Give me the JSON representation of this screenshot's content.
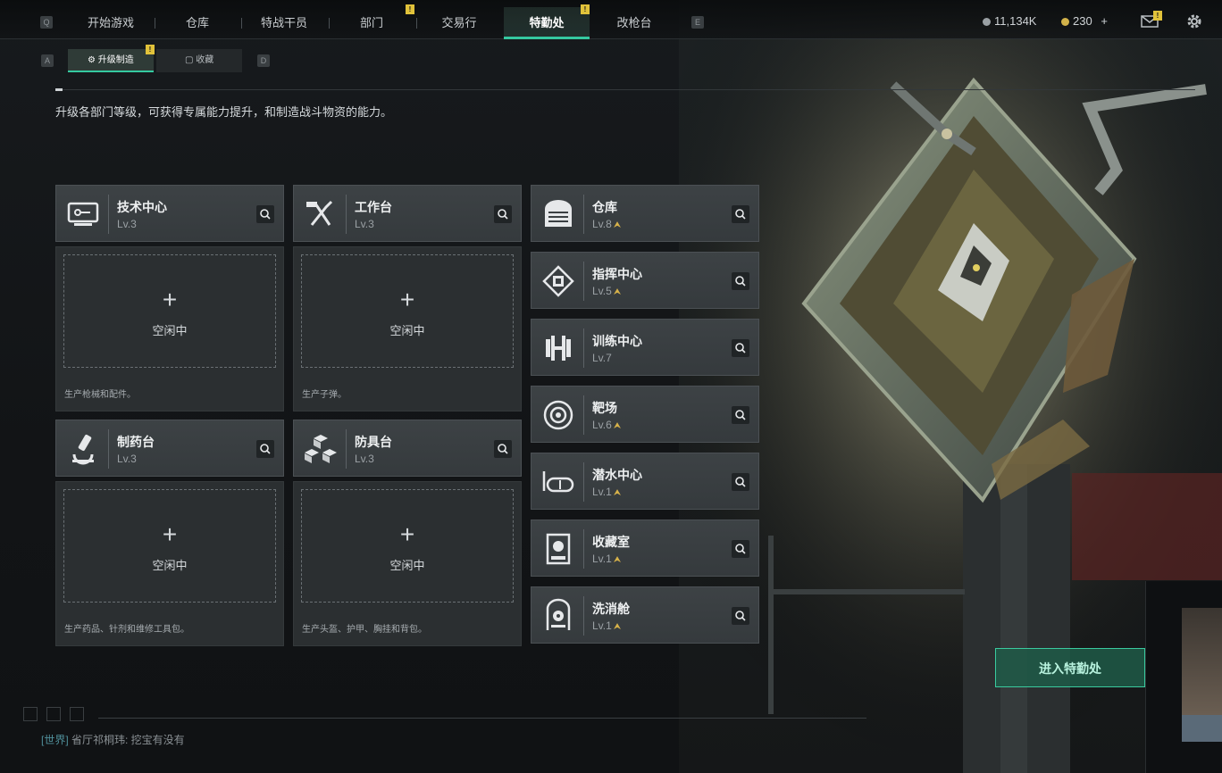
{
  "topbar": {
    "left_key": "Q",
    "right_key": "E",
    "tabs": [
      {
        "label": "开始游戏",
        "badge": ""
      },
      {
        "label": "仓库",
        "badge": ""
      },
      {
        "label": "特战干员",
        "badge": ""
      },
      {
        "label": "部门",
        "badge": "!"
      },
      {
        "label": "交易行",
        "badge": ""
      },
      {
        "label": "特勤处",
        "badge": "!",
        "active": true
      },
      {
        "label": "改枪台",
        "badge": ""
      }
    ],
    "currency_1": "11,134K",
    "currency_2": "230",
    "currency_2_add": "+",
    "mail_badge": "!"
  },
  "subtabs": {
    "left_key": "A",
    "right_key": "D",
    "items": [
      {
        "label": "升级制造",
        "badge": "!",
        "active": true
      },
      {
        "label": "收藏",
        "badge": ""
      }
    ]
  },
  "description": "升级各部门等级，可获得专属能力提升，和制造战斗物资的能力。",
  "production_facilities": [
    {
      "name": "技术中心",
      "level": "Lv.3",
      "icon": "computer-icon",
      "slot_status": "空闲中",
      "slot_plus": "+",
      "slot_desc": "生产枪械和配件。"
    },
    {
      "name": "工作台",
      "level": "Lv.3",
      "icon": "tools-icon",
      "slot_status": "空闲中",
      "slot_plus": "+",
      "slot_desc": "生产子弹。"
    },
    {
      "name": "制药台",
      "level": "Lv.3",
      "icon": "microscope-icon",
      "slot_status": "空闲中",
      "slot_plus": "+",
      "slot_desc": "生产药品、针剂和维修工具包。"
    },
    {
      "name": "防具台",
      "level": "Lv.3",
      "icon": "boxes-icon",
      "slot_status": "空闲中",
      "slot_plus": "+",
      "slot_desc": "生产头盔、护甲、胸挂和背包。"
    }
  ],
  "other_facilities": [
    {
      "name": "仓库",
      "level": "Lv.8",
      "icon": "warehouse-icon",
      "upgradable": true
    },
    {
      "name": "指挥中心",
      "level": "Lv.5",
      "icon": "chip-icon",
      "upgradable": true
    },
    {
      "name": "训练中心",
      "level": "Lv.7",
      "icon": "dumbbell-icon",
      "upgradable": false
    },
    {
      "name": "靶场",
      "level": "Lv.6",
      "icon": "target-icon",
      "upgradable": true
    },
    {
      "name": "潜水中心",
      "level": "Lv.1",
      "icon": "diving-mask-icon",
      "upgradable": true
    },
    {
      "name": "收藏室",
      "level": "Lv.1",
      "icon": "display-case-icon",
      "upgradable": true
    },
    {
      "name": "洗消舱",
      "level": "Lv.1",
      "icon": "radiation-icon",
      "upgradable": true
    }
  ],
  "enter_button": "进入特勤处",
  "chat": {
    "channel": "[世界]",
    "message": "省厅祁桐玮: 挖宝有没有"
  },
  "colors": {
    "accent": "#35c9a0",
    "badge": "#e1c23a",
    "upgrade_arrow": "#d7b24a"
  }
}
